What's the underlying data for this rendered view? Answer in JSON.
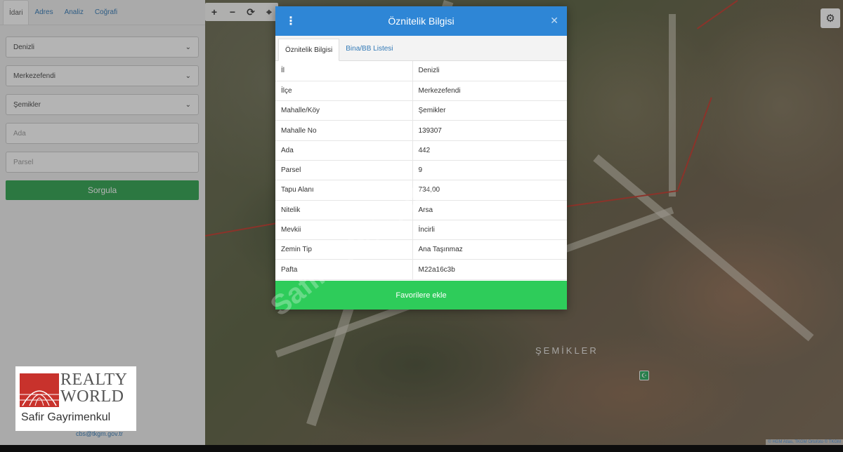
{
  "left_panel": {
    "tabs": [
      "İdari",
      "Adres",
      "Analiz",
      "Coğrafi"
    ],
    "fields": {
      "province": "Denizli",
      "district": "Merkezefendi",
      "neighborhood": "Şemikler",
      "block_placeholder": "Ada",
      "parcel_placeholder": "Parsel"
    },
    "query_button": "Sorgula",
    "footer_email": "cbs@tkgm.gov.tr"
  },
  "logo": {
    "line1": "REALTY",
    "line2": "WORLD",
    "subtitle": "Safir Gayrimenkul"
  },
  "map": {
    "toolbar": [
      "+",
      "−",
      "⟳",
      "⌖"
    ],
    "place_label": "ŞEMİKLER",
    "attribution": "© HGM Atlas, TKGM Ortofoto © TKGM"
  },
  "modal": {
    "title": "Öznitelik Bilgisi",
    "tabs": [
      "Öznitelik Bilgisi",
      "Bina/BB Listesi"
    ],
    "rows": [
      {
        "key": "İl",
        "value": "Denizli"
      },
      {
        "key": "İlçe",
        "value": "Merkezefendi"
      },
      {
        "key": "Mahalle/Köy",
        "value": "Şemikler"
      },
      {
        "key": "Mahalle No",
        "value": "139307"
      },
      {
        "key": "Ada",
        "value": "442"
      },
      {
        "key": "Parsel",
        "value": "9"
      },
      {
        "key": "Tapu Alanı",
        "value": "734,00"
      },
      {
        "key": "Nitelik",
        "value": "Arsa"
      },
      {
        "key": "Mevkii",
        "value": "İncirli"
      },
      {
        "key": "Zemin Tip",
        "value": "Ana Taşınmaz"
      },
      {
        "key": "Pafta",
        "value": "M22a16c3b"
      }
    ],
    "favorite_button": "Favorilere ekle"
  },
  "colors": {
    "header_blue": "#2e86d6",
    "primary_green": "#2ecc5a",
    "query_green": "#2ea44f",
    "logo_red": "#c8322c"
  }
}
